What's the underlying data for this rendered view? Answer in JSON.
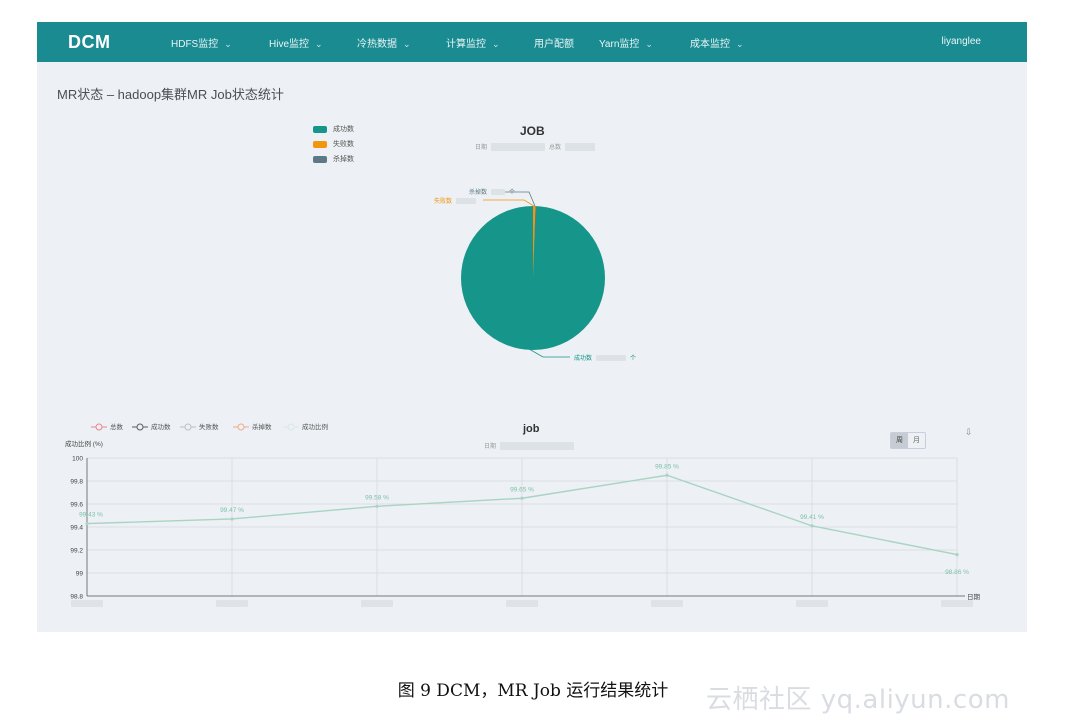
{
  "nav": {
    "logo": "DCM",
    "items": [
      {
        "label": "HDFS监控",
        "dropdown": true
      },
      {
        "label": "Hive监控",
        "dropdown": true
      },
      {
        "label": "冷热数据",
        "dropdown": true
      },
      {
        "label": "计算监控",
        "dropdown": true
      },
      {
        "label": "用户配额",
        "dropdown": false
      },
      {
        "label": "Yarn监控",
        "dropdown": true
      },
      {
        "label": "成本监控",
        "dropdown": true
      }
    ],
    "caret": "⌄",
    "user": "liyanglee"
  },
  "page_title": "MR状态 – hadoop集群MR Job状态统计",
  "pie": {
    "title": "JOB",
    "subtitle_left": "日期",
    "subtitle_right": "总数",
    "legend": [
      {
        "label": "成功数",
        "color": "#16968a"
      },
      {
        "label": "失败数",
        "color": "#f2950f"
      },
      {
        "label": "杀掉数",
        "color": "#5c7a86"
      }
    ],
    "labels": {
      "killed": "杀掉数",
      "killed_unit": "个",
      "failed": "失败数",
      "success": "成功数",
      "success_unit": "个"
    }
  },
  "line": {
    "title": "job",
    "subtitle": "日期",
    "legend": [
      {
        "label": "总数",
        "color": "#e8868f"
      },
      {
        "label": "成功数",
        "color": "#555f66"
      },
      {
        "label": "失败数",
        "color": "#b9c1c9"
      },
      {
        "label": "杀掉数",
        "color": "#f0a98c"
      },
      {
        "label": "成功比例",
        "color": "#d7e9e2"
      }
    ],
    "toggle": [
      "周",
      "月"
    ],
    "toggle_selected": "周",
    "export_icon": "export-icon"
  },
  "chart_data": {
    "type": "line",
    "ylabel": "成功比例 (%)",
    "xlabel": "日期",
    "ylim": [
      98.8,
      100
    ],
    "yticks": [
      "100",
      "99.8",
      "99.6",
      "99.4",
      "99.2",
      "99",
      "98.8"
    ],
    "grid": true,
    "series": [
      {
        "name": "成功比例",
        "color": "#a8d4c2",
        "values": [
          99.43,
          99.47,
          99.58,
          99.65,
          99.85,
          99.41,
          99.16
        ],
        "labels": [
          "99.43 %",
          "99.47 %",
          "99.58 %",
          "99.65 %",
          "99.85 %",
          "99.41 %",
          "98.86 %"
        ]
      }
    ]
  },
  "caption": "图 9 DCM，MR Job 运行结果统计",
  "watermark": "云栖社区 yq.aliyun.com"
}
